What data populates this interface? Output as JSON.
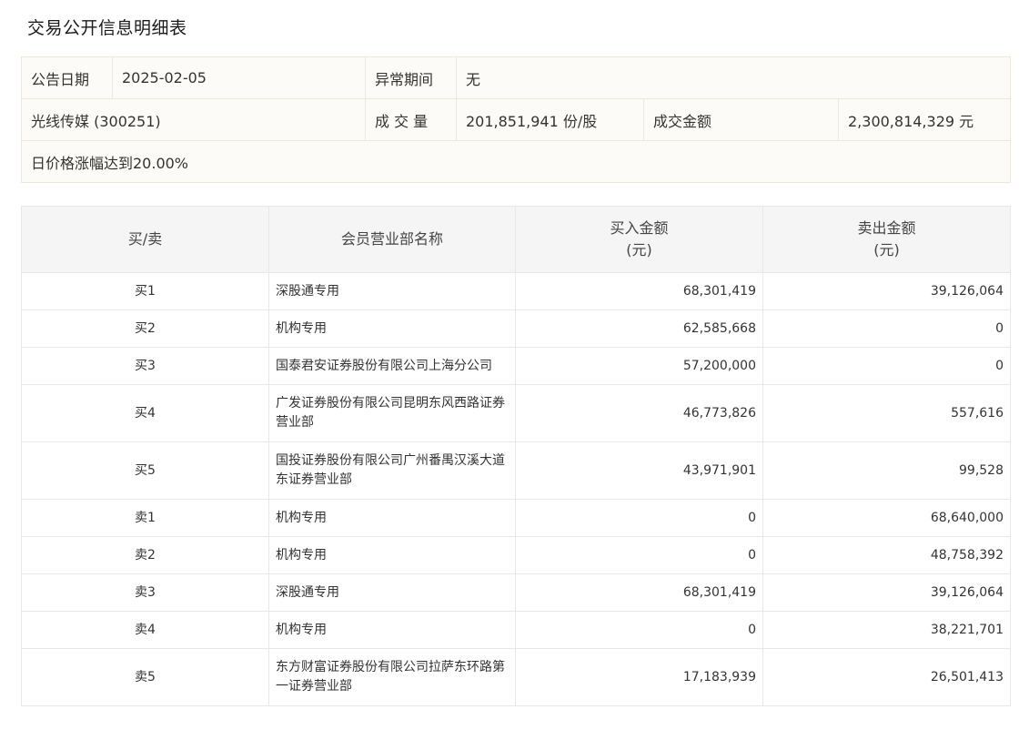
{
  "page_title": "交易公开信息明细表",
  "info": {
    "date_label": "公告日期",
    "date_value": "2025-02-05",
    "period_label": "异常期间",
    "period_value": "无",
    "stock_value": "光线传媒 (300251)",
    "volume_label": "成 交 量",
    "volume_value": "201,851,941 份/股",
    "amount_label": "成交金额",
    "amount_value": "2,300,814,329 元",
    "reason": "日价格涨幅达到20.00%"
  },
  "table": {
    "headers": {
      "side": "买/卖",
      "member": "会员营业部名称",
      "buy_line1": "买入金额",
      "buy_line2": "(元)",
      "sell_line1": "卖出金额",
      "sell_line2": "(元)"
    },
    "rows": [
      {
        "side": "买1",
        "member": "深股通专用",
        "buy": "68,301,419",
        "sell": "39,126,064",
        "tall": false
      },
      {
        "side": "买2",
        "member": "机构专用",
        "buy": "62,585,668",
        "sell": "0",
        "tall": false
      },
      {
        "side": "买3",
        "member": "国泰君安证券股份有限公司上海分公司",
        "buy": "57,200,000",
        "sell": "0",
        "tall": false
      },
      {
        "side": "买4",
        "member": "广发证券股份有限公司昆明东风西路证券营业部",
        "buy": "46,773,826",
        "sell": "557,616",
        "tall": true
      },
      {
        "side": "买5",
        "member": "国投证券股份有限公司广州番禺汉溪大道东证券营业部",
        "buy": "43,971,901",
        "sell": "99,528",
        "tall": true
      },
      {
        "side": "卖1",
        "member": "机构专用",
        "buy": "0",
        "sell": "68,640,000",
        "tall": false
      },
      {
        "side": "卖2",
        "member": "机构专用",
        "buy": "0",
        "sell": "48,758,392",
        "tall": false
      },
      {
        "side": "卖3",
        "member": "深股通专用",
        "buy": "68,301,419",
        "sell": "39,126,064",
        "tall": false
      },
      {
        "side": "卖4",
        "member": "机构专用",
        "buy": "0",
        "sell": "38,221,701",
        "tall": false
      },
      {
        "side": "卖5",
        "member": "东方财富证券股份有限公司拉萨东环路第一证券营业部",
        "buy": "17,183,939",
        "sell": "26,501,413",
        "tall": true
      }
    ]
  }
}
